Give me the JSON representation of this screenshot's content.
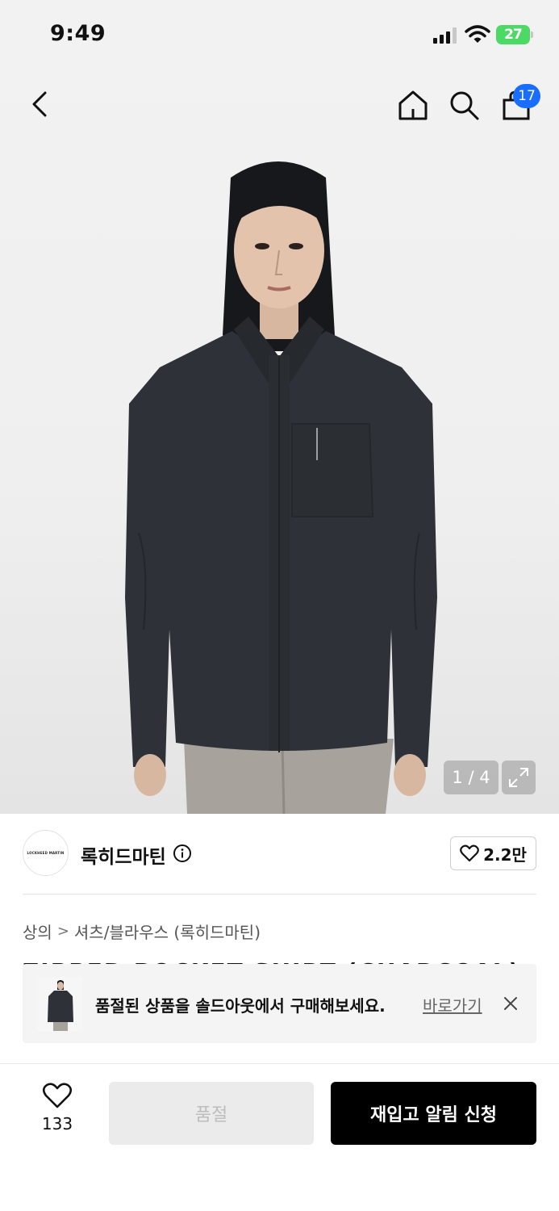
{
  "status_bar": {
    "time": "9:49",
    "battery": "27"
  },
  "header": {
    "icons": [
      "back-icon",
      "home-icon",
      "search-icon",
      "shopping-bag-icon"
    ],
    "cart_count": "17"
  },
  "gallery": {
    "counter": "1 / 4"
  },
  "brand": {
    "logo_text": "LOCKHEED MARTIN",
    "name": "록히드마틴",
    "follow_count": "2.2만"
  },
  "breadcrumb": {
    "category": "상의",
    "separator": ">",
    "subcategory": "셔츠/블라우스 (록히드마틴)"
  },
  "product": {
    "title": "ZIPPED POCKET SHIRT (CHARCOAL)"
  },
  "banner": {
    "message": "품절된 상품을 솔드아웃에서 구매해보세요.",
    "link_label": "바로가기"
  },
  "bottom_bar": {
    "wish_count": "133",
    "soldout_label": "품절",
    "restock_label": "재입고 알림 신청"
  },
  "colors": {
    "accent_blue": "#1a6eff",
    "battery_green": "#4cd964",
    "primary_button": "#000000",
    "disabled_button": "#ebebeb"
  }
}
